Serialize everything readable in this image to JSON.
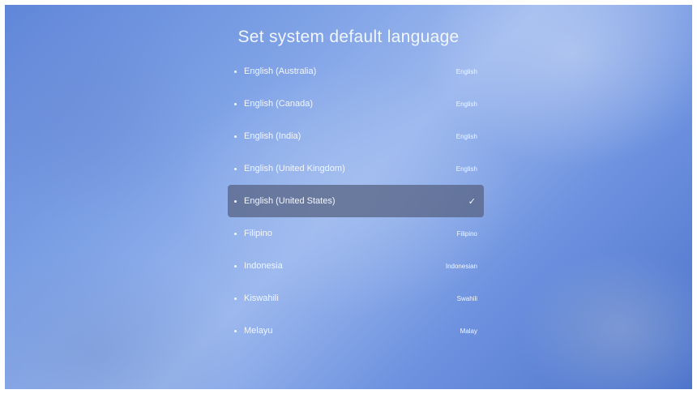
{
  "page": {
    "title": "Set system default language"
  },
  "languages": [
    {
      "name": "English (Australia)",
      "native": "English",
      "selected": false
    },
    {
      "name": "English (Canada)",
      "native": "English",
      "selected": false
    },
    {
      "name": "English (India)",
      "native": "English",
      "selected": false
    },
    {
      "name": "English (United Kingdom)",
      "native": "English",
      "selected": false
    },
    {
      "name": "English (United States)",
      "native": "",
      "selected": true,
      "indicator": "✓"
    },
    {
      "name": "Filipino",
      "native": "Filipino",
      "selected": false
    },
    {
      "name": "Indonesia",
      "native": "Indonesian",
      "selected": false
    },
    {
      "name": "Kiswahili",
      "native": "Swahili",
      "selected": false
    },
    {
      "name": "Melayu",
      "native": "Malay",
      "selected": false
    }
  ],
  "icons": {
    "selected": "checkmark-icon",
    "bullet": "bullet-icon"
  },
  "colors": {
    "selection": "#556080",
    "text": "#f4f7ff"
  }
}
